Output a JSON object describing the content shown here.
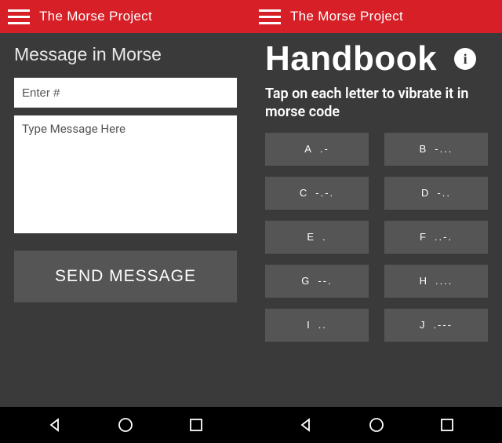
{
  "left": {
    "app_title": "The Morse Project",
    "heading": "Message in Morse",
    "phone_placeholder": "Enter #",
    "message_placeholder": "Type Message Here",
    "send_label": "SEND MESSAGE"
  },
  "right": {
    "app_title": "The Morse Project",
    "heading": "Handbook",
    "info_glyph": "i",
    "subheading": "Tap on each letter to vibrate it in morse code",
    "letters": [
      {
        "letter": "A",
        "code": ".-"
      },
      {
        "letter": "B",
        "code": "-..."
      },
      {
        "letter": "C",
        "code": "-.-."
      },
      {
        "letter": "D",
        "code": "-.."
      },
      {
        "letter": "E",
        "code": "."
      },
      {
        "letter": "F",
        "code": "..-."
      },
      {
        "letter": "G",
        "code": "--."
      },
      {
        "letter": "H",
        "code": "...."
      },
      {
        "letter": "I",
        "code": ".."
      },
      {
        "letter": "J",
        "code": ".---"
      }
    ]
  }
}
